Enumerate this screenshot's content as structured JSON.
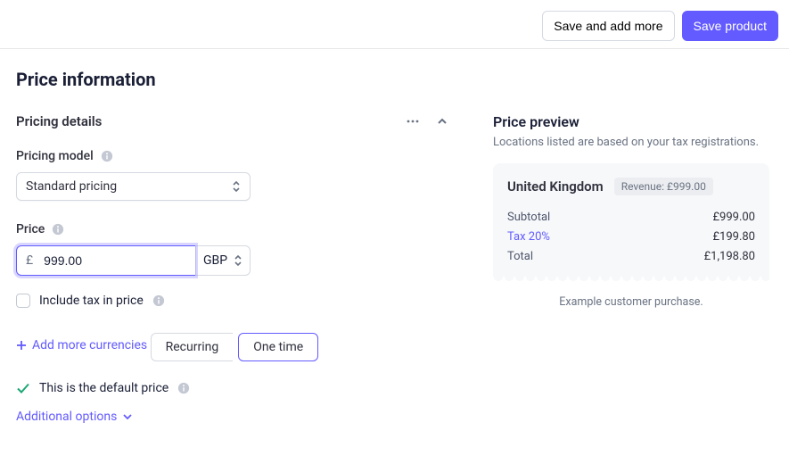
{
  "actions": {
    "save_more": "Save and add more",
    "save_product": "Save product"
  },
  "page_title": "Price information",
  "pricing_details": {
    "header": "Pricing details",
    "model_label": "Pricing model",
    "model_value": "Standard pricing",
    "price_label": "Price",
    "currency_symbol": "£",
    "price_value": "999.00",
    "currency_code": "GBP",
    "include_tax_label": "Include tax in price",
    "add_currencies": "Add more currencies",
    "toggle_recurring": "Recurring",
    "toggle_onetime": "One time",
    "default_text": "This is the default price",
    "additional_options": "Additional options"
  },
  "preview": {
    "title": "Price preview",
    "subtitle": "Locations listed are based on your tax registrations.",
    "location": "United Kingdom",
    "revenue_badge": "Revenue: £999.00",
    "rows": {
      "subtotal_label": "Subtotal",
      "subtotal_value": "£999.00",
      "tax_label": "Tax 20%",
      "tax_value": "£199.80",
      "total_label": "Total",
      "total_value": "£1,198.80"
    },
    "caption": "Example customer purchase."
  }
}
